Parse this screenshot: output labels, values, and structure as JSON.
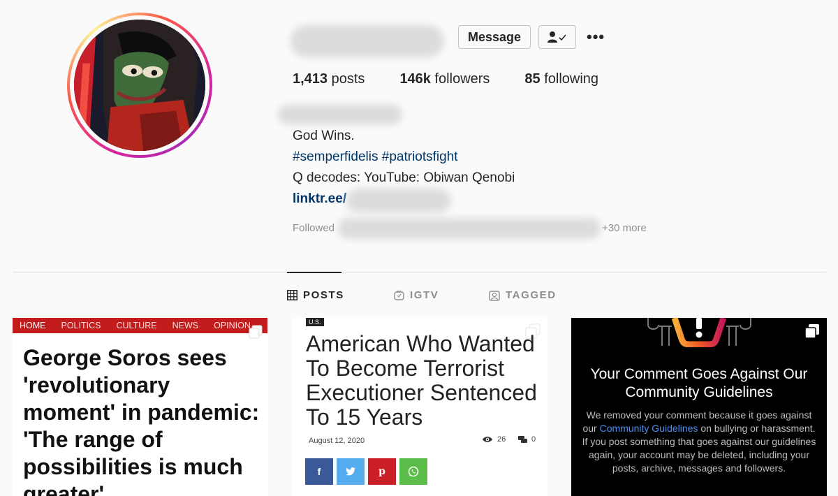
{
  "profile": {
    "message_label": "Message",
    "follow_icon": "person-check-icon",
    "more_label": "•••",
    "stats": {
      "posts_count": "1,413",
      "posts_label": "posts",
      "followers_count": "146k",
      "followers_label": "followers",
      "following_count": "85",
      "following_label": "following"
    },
    "bio": {
      "line1": "God Wins.",
      "line2": "#semperfidelis #patriotsfight",
      "line3": "Q decodes: YouTube: Obiwan Qenobi",
      "link": "linktr.ee/"
    },
    "followed_by_prefix": "Followed",
    "followed_by_suffix": "+30 more"
  },
  "tabs": [
    {
      "label": "POSTS",
      "icon": "grid-icon",
      "active": true
    },
    {
      "label": "IGTV",
      "icon": "tv-icon",
      "active": false
    },
    {
      "label": "TAGGED",
      "icon": "tagged-icon",
      "active": false
    }
  ],
  "posts": {
    "post1": {
      "nav": [
        "HOME",
        "POLITICS",
        "CULTURE",
        "NEWS",
        "OPINION"
      ],
      "headline": "George Soros sees 'revolutionary moment' in pandemic: 'The range of possibilities is much greater'"
    },
    "post2": {
      "tag": "U.S.",
      "headline": "American Who Wanted To Become Terrorist Executioner Sentenced To 15 Years",
      "date": "August 12, 2020",
      "views": "26",
      "comments": "0",
      "share_icons": [
        "facebook-icon",
        "twitter-icon",
        "pinterest-icon",
        "whatsapp-icon"
      ]
    },
    "post3": {
      "title": "Your Comment Goes Against Our Community Guidelines",
      "body_before": "We removed your comment because it goes against our ",
      "body_link": "Community Guidelines",
      "body_after": " on bullying or harassment. If you post something that goes against our guidelines again, your account may be deleted, including your posts, archive, messages and followers."
    }
  },
  "colors": {
    "link_blue": "#00376b",
    "nav_red": "#c21c1c",
    "guidelines_link": "#4b8ff0"
  }
}
